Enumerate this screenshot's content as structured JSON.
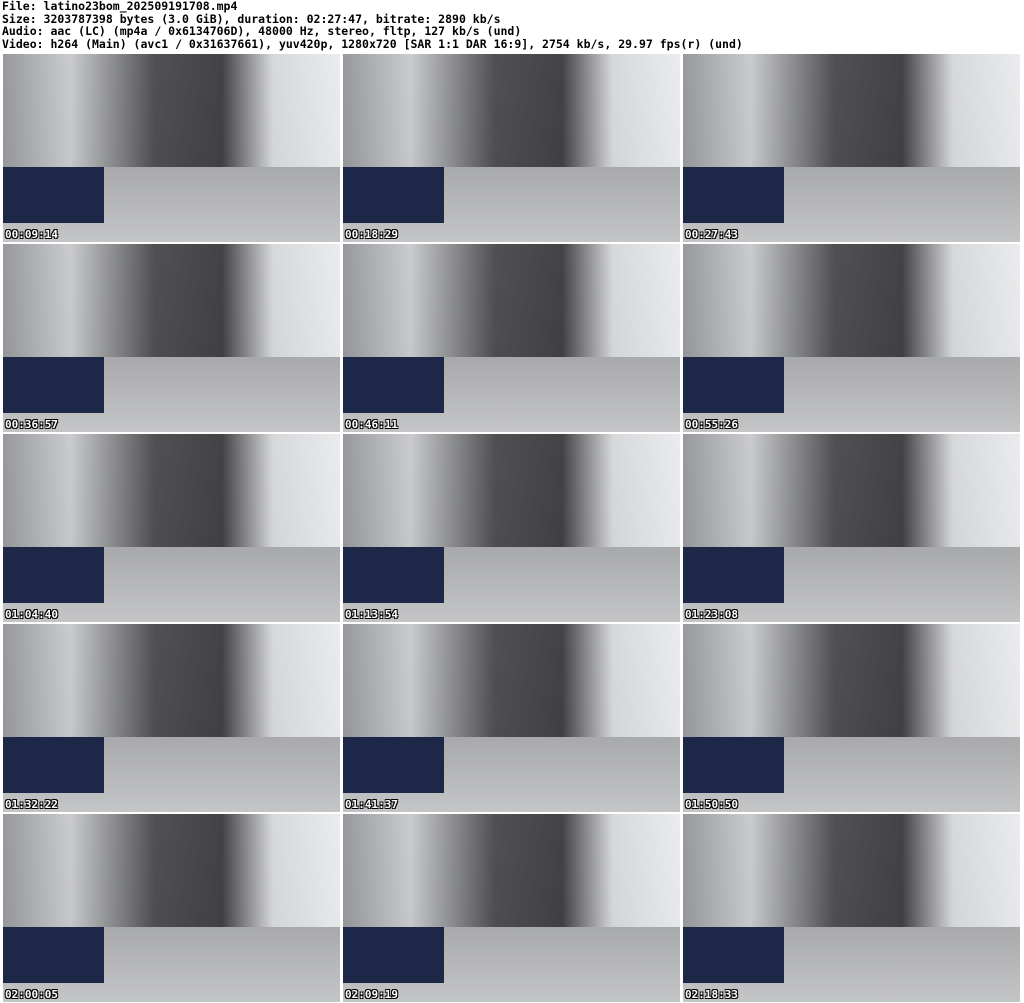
{
  "header": {
    "file": "File: latino23bom_202509191708.mp4",
    "size": "Size: 3203787398 bytes (3.0 GiB), duration: 02:27:47, bitrate: 2890 kb/s",
    "audio": "Audio: aac (LC) (mp4a / 0x6134706D), 48000 Hz, stereo, fltp, 127 kb/s (und)",
    "video": "Video: h264 (Main) (avc1 / 0x31637661), yuv420p, 1280x720 [SAR 1:1 DAR 16:9], 2754 kb/s, 29.97 fps(r) (und)"
  },
  "thumbnails": [
    {
      "timestamp": "00:09:14"
    },
    {
      "timestamp": "00:18:29"
    },
    {
      "timestamp": "00:27:43"
    },
    {
      "timestamp": "00:36:57"
    },
    {
      "timestamp": "00:46:11"
    },
    {
      "timestamp": "00:55:26"
    },
    {
      "timestamp": "01:04:40"
    },
    {
      "timestamp": "01:13:54"
    },
    {
      "timestamp": "01:23:08"
    },
    {
      "timestamp": "01:32:22"
    },
    {
      "timestamp": "01:41:37"
    },
    {
      "timestamp": "01:50:50"
    },
    {
      "timestamp": "02:00:05"
    },
    {
      "timestamp": "02:09:19"
    },
    {
      "timestamp": "02:18:33"
    }
  ]
}
